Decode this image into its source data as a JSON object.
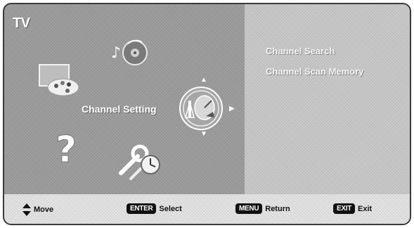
{
  "menu": {
    "title": "TV"
  },
  "selected": {
    "label": "Channel Setting",
    "icon": "channel-setting-icon"
  },
  "icons": [
    "sound-icon",
    "picture-icon",
    "channel-setting-icon",
    "help-icon",
    "setup-timer-icon"
  ],
  "submenu": {
    "items": [
      "Channel Search",
      "Channel Scan Memory"
    ]
  },
  "footer": {
    "move_label": "Move",
    "enter_key": "ENTER",
    "select_label": "Select",
    "menu_key": "MENU",
    "return_label": "Return",
    "exit_key": "EXIT",
    "exit_label": "Exit"
  }
}
